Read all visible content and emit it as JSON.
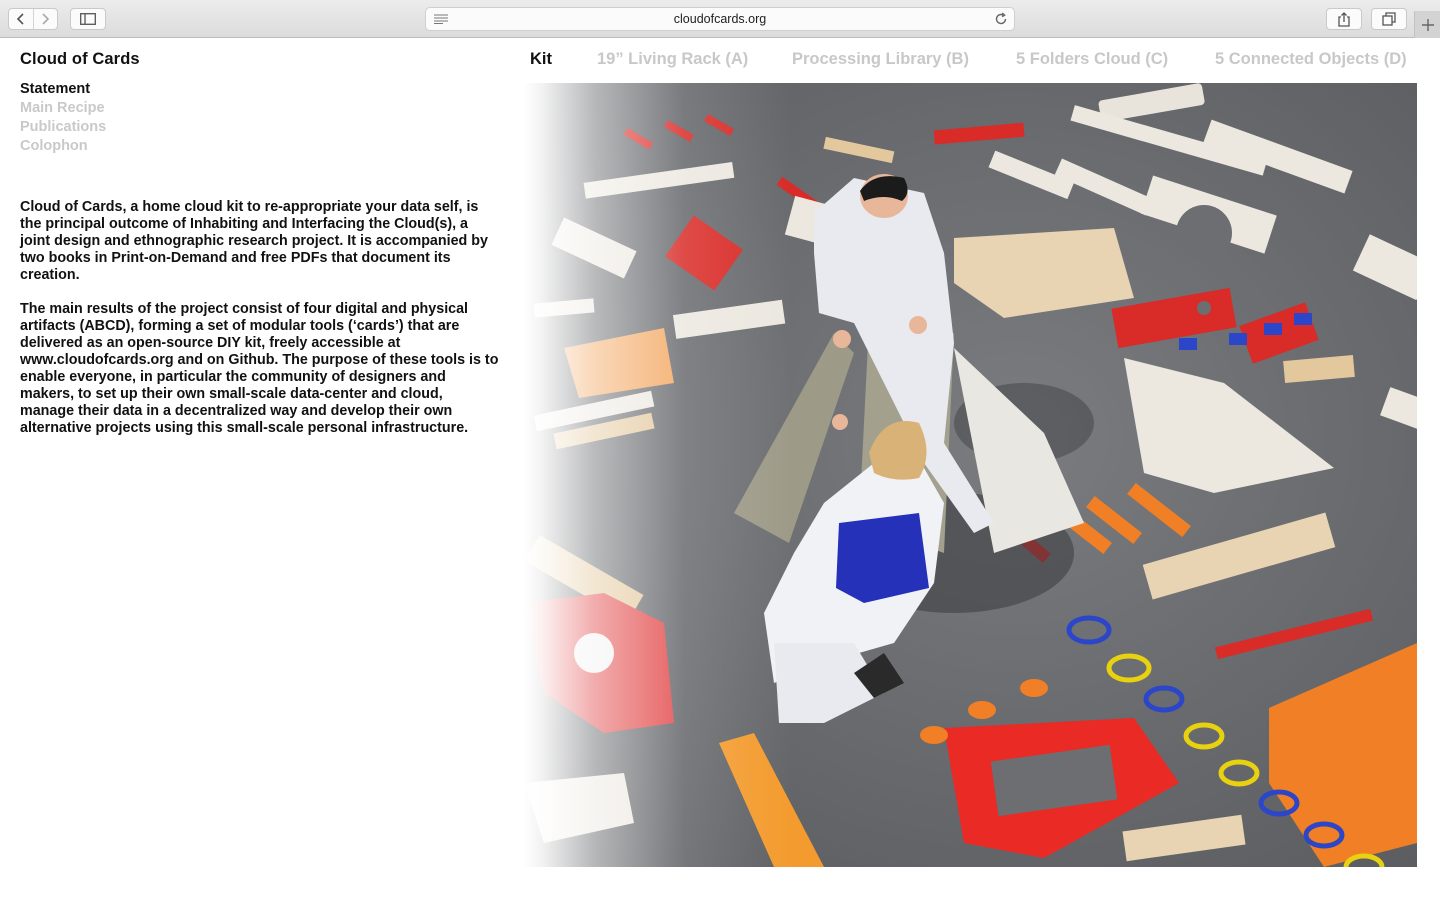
{
  "browser": {
    "url": "cloudofcards.org"
  },
  "site": {
    "title": "Cloud of Cards"
  },
  "side_nav": {
    "items": [
      {
        "label": "Statement",
        "active": true
      },
      {
        "label": "Main Recipe",
        "active": false
      },
      {
        "label": "Publications",
        "active": false
      },
      {
        "label": "Colophon",
        "active": false
      }
    ]
  },
  "tabs": [
    {
      "label": "Kit",
      "active": true
    },
    {
      "label": "19” Living Rack (A)",
      "active": false
    },
    {
      "label": "Processing Library (B)",
      "active": false
    },
    {
      "label": "5 Folders Cloud (C)",
      "active": false
    },
    {
      "label": "5 Connected Objects (D)",
      "active": false
    }
  ],
  "statement": {
    "paragraph_1": "Cloud of Cards, a home cloud kit to re-appropriate your data self, is the principal outcome of Inhabiting and Interfacing the Cloud(s), a joint design and ethnographic research project. It is accompanied by two books in Print-on-Demand and free PDFs that document its creation.",
    "paragraph_2": "The main results of the project consist of four digital and physical artifacts (ABCD), forming a set of modular tools (‘cards’) that are delivered as an open-source DIY kit, freely accessible at www.cloudofcards.org and on Github. The purpose of these tools is to enable everyone, in particular the community of designers and makers, to set up their own small-scale data-center and cloud, manage their data in a decentralized way and develop their own alternative projects using this small-scale personal infrastructure."
  },
  "colors": {
    "text": "#111111",
    "muted": "#c8c8c8",
    "floor": "#6c6e72",
    "plywood": "#e8d3b3",
    "red": "#d92b27",
    "orange": "#f07f25",
    "blue_cable": "#2b46c8",
    "yellow_cable": "#e8d10f"
  }
}
